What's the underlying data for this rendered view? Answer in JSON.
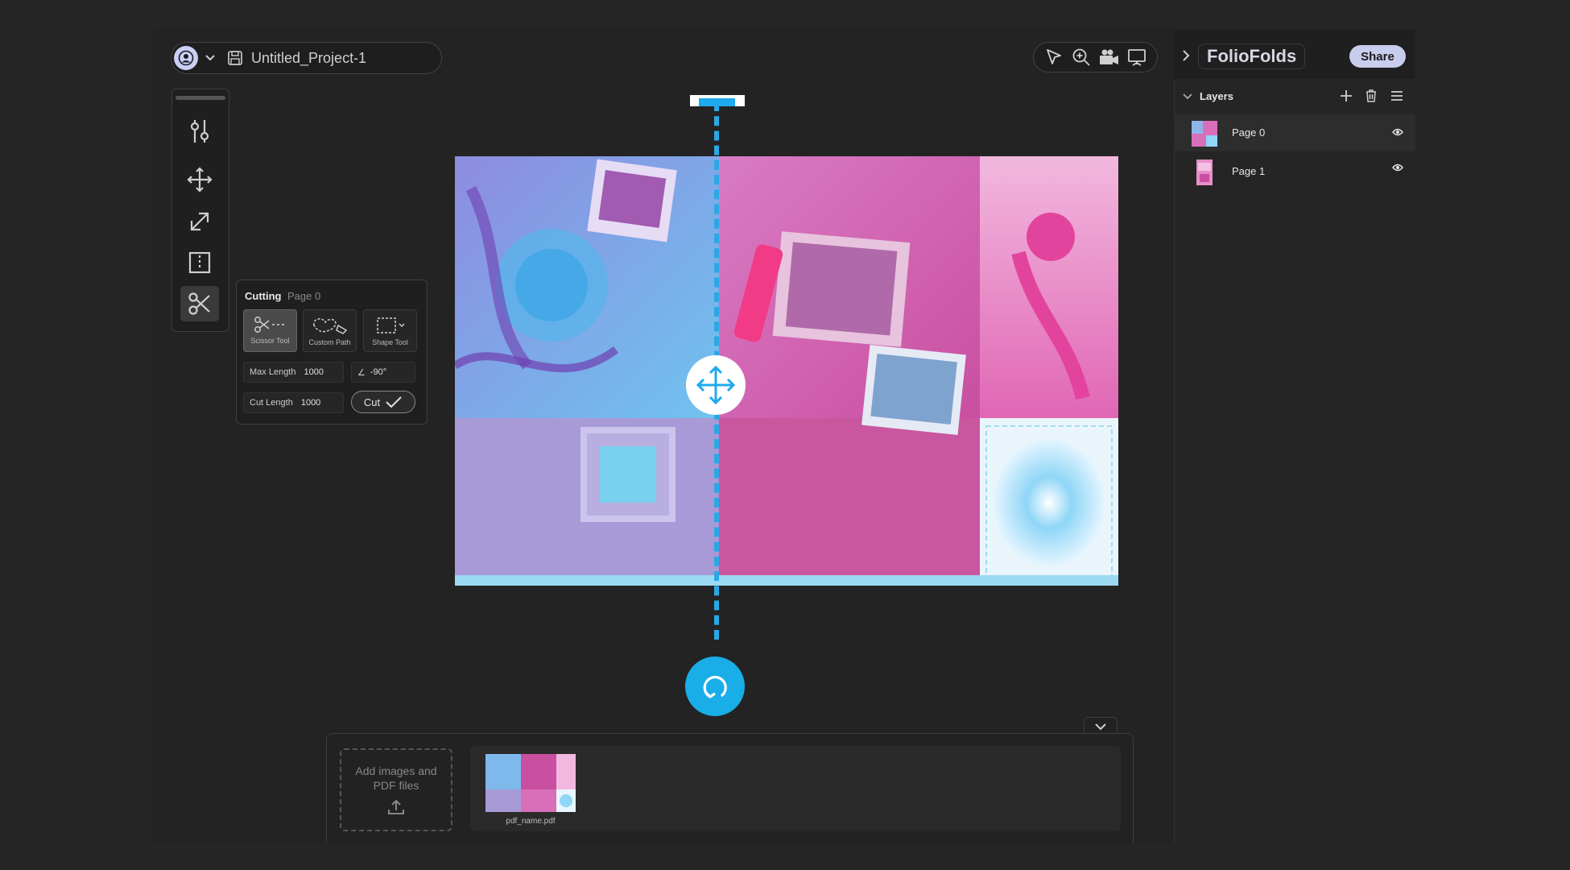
{
  "project": {
    "name": "Untitled_Project-1"
  },
  "cutting_panel": {
    "title": "Cutting",
    "page": "Page 0",
    "tools": [
      {
        "label": "Scissor Tool",
        "active": true
      },
      {
        "label": "Custom Path",
        "active": false
      },
      {
        "label": "Shape Tool",
        "active": false
      }
    ],
    "max_length_label": "Max Length",
    "max_length_value": "1000",
    "angle_symbol": "∠",
    "angle_value": "-90°",
    "cut_length_label": "Cut Length",
    "cut_length_value": "1000",
    "cut_button": "Cut"
  },
  "file_tray": {
    "dropzone_text": "Add images and PDF files",
    "files": [
      {
        "name": "pdf_name.pdf"
      }
    ]
  },
  "right_panel": {
    "brand": "FolioFolds",
    "share_label": "Share",
    "layers_title": "Layers",
    "layers": [
      {
        "name": "Page 0",
        "selected": true
      },
      {
        "name": "Page 1",
        "selected": false
      }
    ]
  },
  "colors": {
    "accent_cyan": "#1fa9ee",
    "share_bg": "#c7cdec",
    "avatar_bg": "#c9cff5"
  }
}
